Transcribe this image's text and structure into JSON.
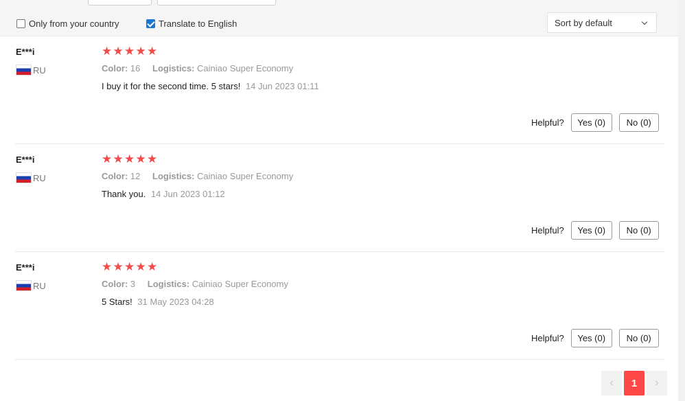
{
  "filters": {
    "only_country_label": "Only from your country",
    "only_country_checked": false,
    "translate_label": "Translate to English",
    "translate_checked": true,
    "sort_label": "Sort by default"
  },
  "reviews": [
    {
      "name": "E***i",
      "country": "RU",
      "stars": "★★★★★",
      "color_label": "Color:",
      "color_value": "16",
      "logistics_label": "Logistics:",
      "logistics_value": "Cainiao Super Economy",
      "text": "I buy it for the second time. 5 stars!",
      "date": "14 Jun 2023 01:11",
      "helpful_label": "Helpful?",
      "yes_label": "Yes (0)",
      "no_label": "No (0)"
    },
    {
      "name": "E***i",
      "country": "RU",
      "stars": "★★★★★",
      "color_label": "Color:",
      "color_value": "12",
      "logistics_label": "Logistics:",
      "logistics_value": "Cainiao Super Economy",
      "text": "Thank you.",
      "date": "14 Jun 2023 01:12",
      "helpful_label": "Helpful?",
      "yes_label": "Yes (0)",
      "no_label": "No (0)"
    },
    {
      "name": "E***i",
      "country": "RU",
      "stars": "★★★★★",
      "color_label": "Color:",
      "color_value": "3",
      "logistics_label": "Logistics:",
      "logistics_value": "Cainiao Super Economy",
      "text": "5 Stars!",
      "date": "31 May 2023 04:28",
      "helpful_label": "Helpful?",
      "yes_label": "Yes (0)",
      "no_label": "No (0)"
    }
  ],
  "pagination": {
    "prev": "‹",
    "current": "1",
    "next": "›"
  },
  "colors": {
    "star": "#f44a4a",
    "active_page": "#ff4747",
    "checkbox_checked": "#1976d2"
  }
}
